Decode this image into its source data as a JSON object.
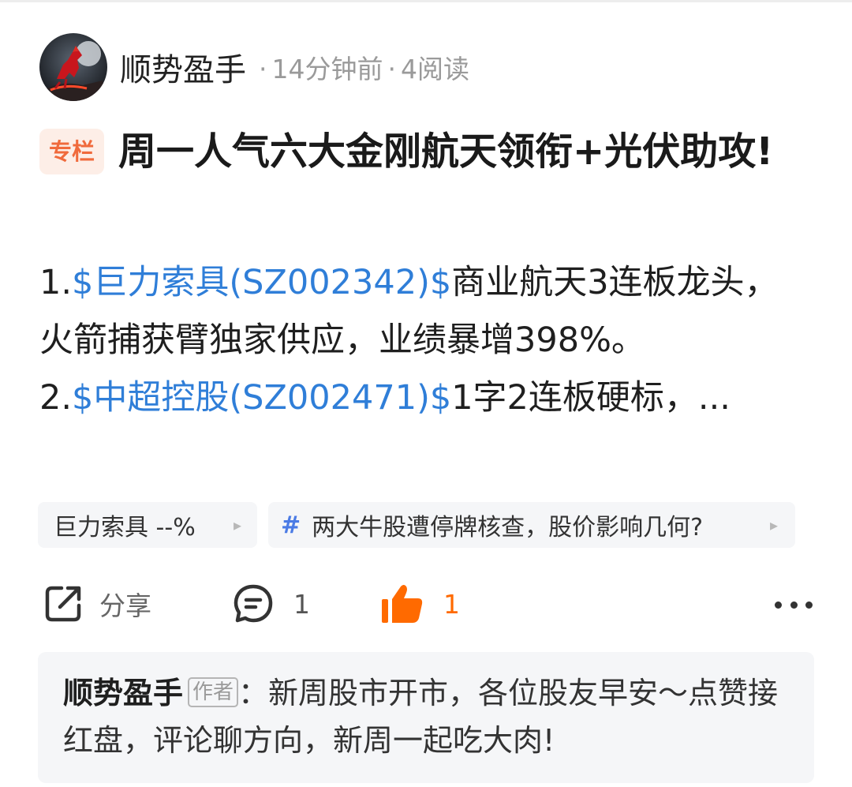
{
  "header": {
    "author_name": "顺势盈手",
    "time_ago": "14分钟前",
    "read_count": "4阅读",
    "separator": "·"
  },
  "post": {
    "column_tag": "专栏",
    "title": "周一人气六大金刚航天领衔+光伏助攻!",
    "items": [
      {
        "number": "1.",
        "stock": "$巨力索具(SZ002342)$",
        "text": "商业航天3连板龙头，火箭捕获臂独家供应，业绩暴增398%。"
      },
      {
        "number": "2.",
        "stock": "$中超控股(SZ002471)$",
        "text": "1字2连板硬标，..."
      }
    ]
  },
  "chips": {
    "stock": {
      "name": "巨力索具",
      "change": "--%",
      "arrow": "▸"
    },
    "topic": {
      "hash": "#",
      "text": "两大牛股遭停牌核查，股价影响几何?",
      "arrow": "▸"
    }
  },
  "actions": {
    "share_label": "分享",
    "comment_count": "1",
    "like_count": "1",
    "colors": {
      "like": "#ff6a00",
      "link": "#2f7ed8",
      "tag": "#f06a3c"
    }
  },
  "comment_preview": {
    "author": "顺势盈手",
    "author_tag": "作者",
    "separator": "：",
    "text": "新周股市开市，各位股友早安～点赞接红盘，评论聊方向，新周一起吃大肉!"
  },
  "icons": {
    "share": "share-icon",
    "comment": "comment-bubble-icon",
    "like": "thumbs-up-icon",
    "more": "more-dots-icon"
  }
}
